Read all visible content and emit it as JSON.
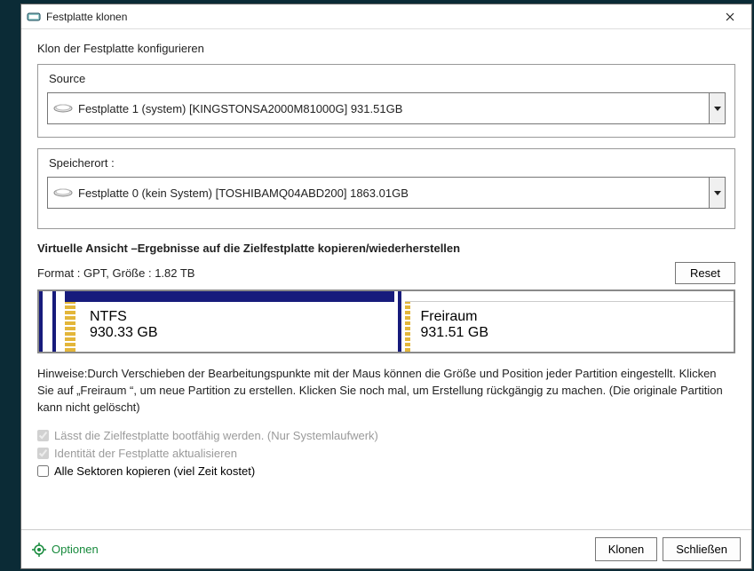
{
  "window": {
    "title": "Festplatte klonen"
  },
  "subtitle": "Klon der Festplatte konfigurieren",
  "source": {
    "label": "Source",
    "selected": "Festplatte 1 (system) [KINGSTONSA2000M81000G]   931.51GB"
  },
  "target": {
    "label": "Speicherort :",
    "selected": "Festplatte 0 (kein System) [TOSHIBAMQ04ABD200]   1863.01GB"
  },
  "preview": {
    "title": "Virtuelle Ansicht –Ergebnisse auf die Zielfestplatte kopieren/wiederherstellen",
    "format_line": "Format : GPT,  Größe : 1.82 TB",
    "reset_label": "Reset",
    "partitions": [
      {
        "name": "NTFS",
        "size": "930.33 GB",
        "type": "used"
      },
      {
        "name": "Freiraum",
        "size": "931.51 GB",
        "type": "free"
      }
    ]
  },
  "hint": "Hinweise:Durch Verschieben der Bearbeitungspunkte mit der Maus können die Größe und Position jeder Partition eingestellt. Klicken Sie auf „Freiraum “, um neue Partition zu erstellen. Klicken Sie noch mal, um Erstellung rückgängig zu machen. (Die originale Partition kann nicht gelöscht)",
  "checks": {
    "bootable": {
      "label": "Lässt die Zielfestplatte bootfähig werden. (Nur Systemlaufwerk)",
      "checked": true,
      "enabled": false
    },
    "identity": {
      "label": "Identität der Festplatte aktualisieren",
      "checked": true,
      "enabled": false
    },
    "allsectors": {
      "label": "Alle Sektoren kopieren (viel Zeit kostet)",
      "checked": false,
      "enabled": true
    }
  },
  "footer": {
    "options": "Optionen",
    "clone": "Klonen",
    "close": "Schließen"
  }
}
